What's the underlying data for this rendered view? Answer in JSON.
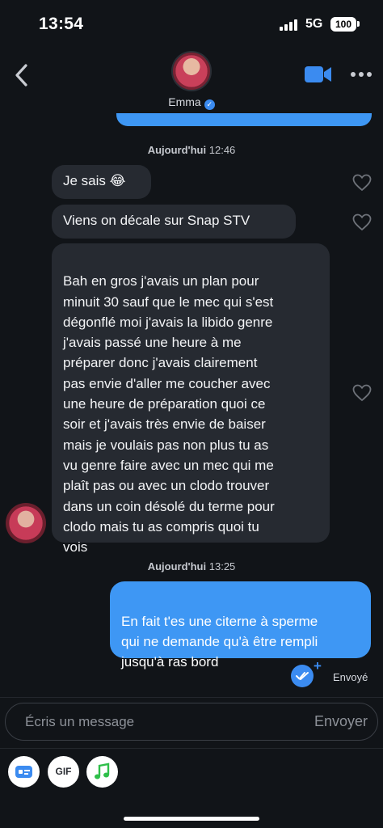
{
  "status_bar": {
    "time": "13:54",
    "network": "5G",
    "battery": "100"
  },
  "header": {
    "contact_name": "Emma"
  },
  "conversation": {
    "timestamp1": {
      "day": "Aujourd'hui",
      "time": "12:46"
    },
    "received": [
      "Je sais 😂",
      "Viens on décale sur Snap STV",
      "Bah en gros j'avais un plan pour\nminuit 30 sauf que le mec qui s'est\ndégonflé moi j'avais la libido genre\nj'avais passé une heure à me\npréparer donc j'avais clairement\npas envie d'aller me coucher avec\nune heure de préparation quoi ce\nsoir et j'avais très envie de baiser\nmais je voulais pas non plus tu as\nvu genre faire avec un mec qui me\nplaît pas ou avec un clodo trouver\ndans un coin désolé du terme pour\nclodo mais tu as compris quoi tu\nvois"
    ],
    "timestamp2": {
      "day": "Aujourd'hui",
      "time": "13:25"
    },
    "sent": "En fait t'es une citerne à sperme\nqui ne demande qu'à être rempli\njusqu'à ras bord",
    "sent_status": "Envoyé"
  },
  "composer": {
    "placeholder": "Écris un message",
    "send_label": "Envoyer"
  },
  "toolbar": {
    "gif_label": "GIF"
  },
  "colors": {
    "accent": "#3e97f4",
    "bubble_in": "#262a31",
    "background": "#111418"
  }
}
